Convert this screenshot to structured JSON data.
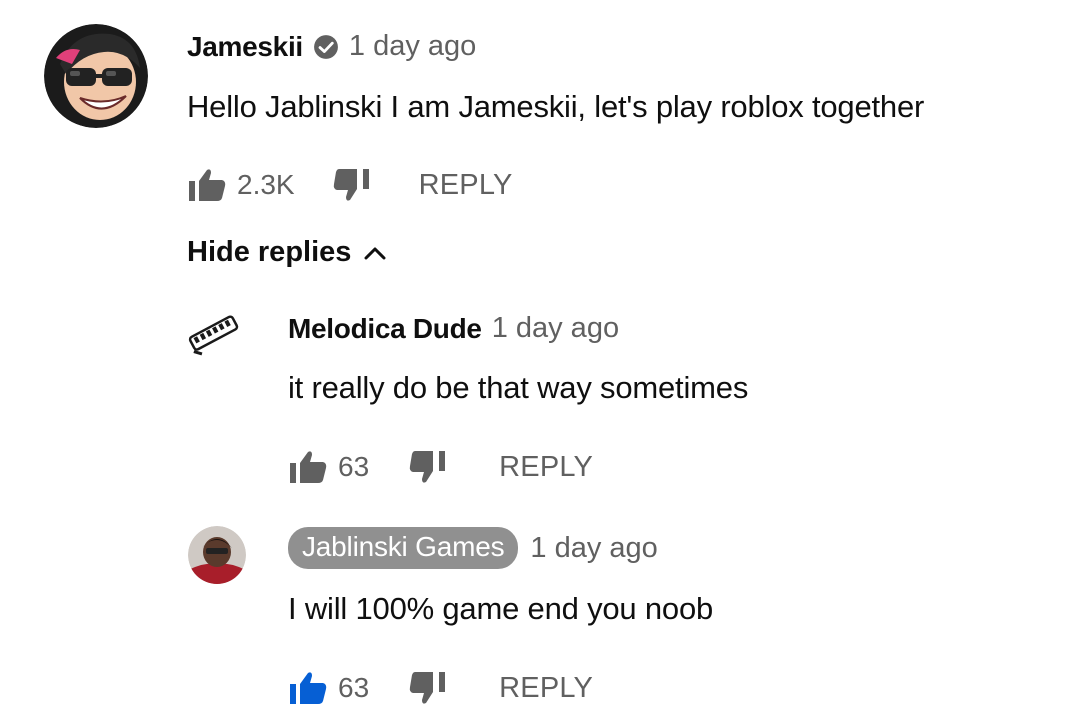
{
  "comments": [
    {
      "author": "Jameskii",
      "verified": true,
      "time": "1 day ago",
      "text": "Hello Jablinski I am Jameskii, let's play roblox together",
      "likes": "2.3K",
      "reply_label": "REPLY",
      "avatar": "cartoon-avatar-with-sunglasses"
    }
  ],
  "hide_replies_label": "Hide replies",
  "replies": [
    {
      "author": "Melodica Dude",
      "time": "1 day ago",
      "text": "it really do be that way sometimes",
      "likes": "63",
      "reply_label": "REPLY",
      "avatar": "melodica-icon",
      "liked": false
    },
    {
      "author": "Jablinski Games",
      "channel_owner": true,
      "time": "1 day ago",
      "text": "I will 100% game end you noob",
      "likes": "63",
      "reply_label": "REPLY",
      "avatar": "person-photo",
      "liked": true
    }
  ],
  "colors": {
    "text": "#0f0f0f",
    "secondary": "#606060",
    "owner_badge": "#909090",
    "liked_blue": "#065fd4"
  }
}
